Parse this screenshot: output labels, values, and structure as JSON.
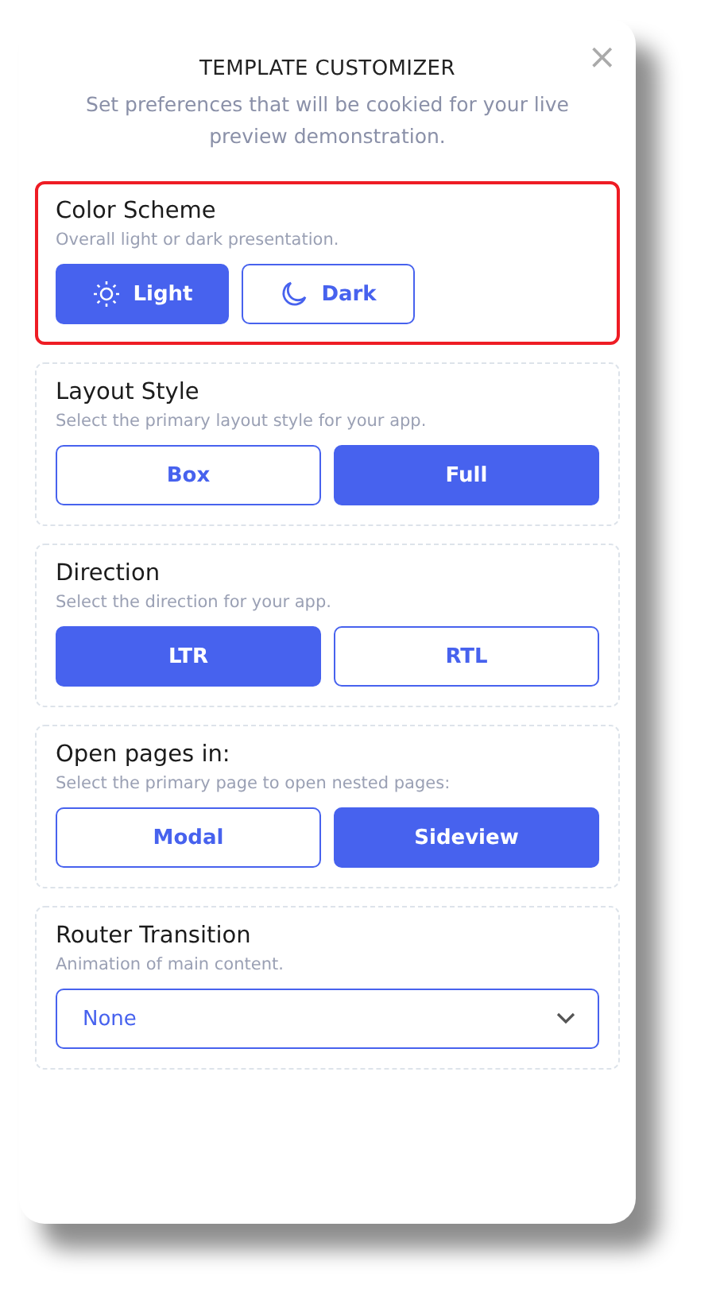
{
  "panel": {
    "title": "TEMPLATE CUSTOMIZER",
    "close": "×",
    "subtitle": "Set preferences that will be cookied for your live preview demonstration."
  },
  "sections": [
    {
      "kind": "scheme",
      "title": "Color Scheme",
      "description": "Overall light or dark presentation.",
      "highlighted": true,
      "options": [
        {
          "label": "Light",
          "selected": true
        },
        {
          "label": "Dark",
          "selected": false
        }
      ]
    },
    {
      "kind": "options",
      "title": "Layout Style",
      "description": "Select the primary layout style for your app.",
      "highlighted": false,
      "options": [
        {
          "label": "Box",
          "selected": false
        },
        {
          "label": "Full",
          "selected": true
        }
      ]
    },
    {
      "kind": "options",
      "title": "Direction",
      "description": "Select the direction for your app.",
      "highlighted": false,
      "options": [
        {
          "label": "LTR",
          "selected": true
        },
        {
          "label": "RTL",
          "selected": false
        }
      ]
    },
    {
      "kind": "options",
      "title": "Open pages in:",
      "description": "Select the primary page to open nested pages:",
      "highlighted": false,
      "options": [
        {
          "label": "Modal",
          "selected": false
        },
        {
          "label": "Sideview",
          "selected": true
        }
      ]
    },
    {
      "kind": "select",
      "title": "Router Transition",
      "description": "Animation of main content.",
      "highlighted": false,
      "value": "None"
    }
  ]
}
